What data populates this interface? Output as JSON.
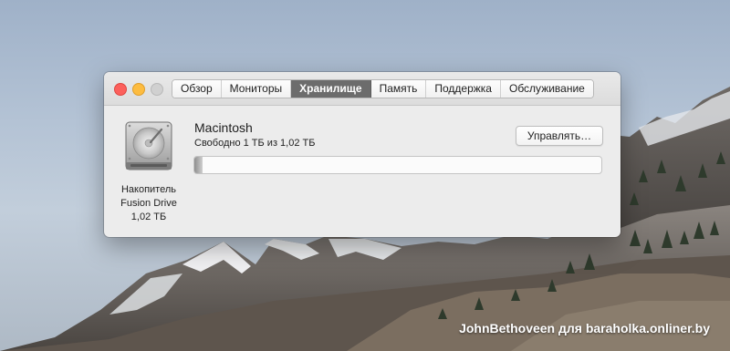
{
  "window": {
    "tabs": [
      {
        "label": "Обзор",
        "active": false
      },
      {
        "label": "Мониторы",
        "active": false
      },
      {
        "label": "Хранилище",
        "active": true
      },
      {
        "label": "Память",
        "active": false
      },
      {
        "label": "Поддержка",
        "active": false
      },
      {
        "label": "Обслуживание",
        "active": false
      }
    ]
  },
  "storage": {
    "drive_icon": "hard-drive-icon",
    "drive_label_lines": [
      "Накопитель",
      "Fusion Drive",
      "1,02 ТБ"
    ],
    "volume_name": "Macintosh",
    "free_text": "Свободно 1 ТБ из 1,02 ТБ",
    "used_fraction": 0.02,
    "manage_label": "Управлять…"
  },
  "watermark": "JohnBethoveen для baraholka.onliner.by",
  "colors": {
    "active_tab": "#6c6c6c",
    "close": "#fc605c",
    "minimize": "#fdbc40",
    "maximize": "#d0d0d0"
  }
}
